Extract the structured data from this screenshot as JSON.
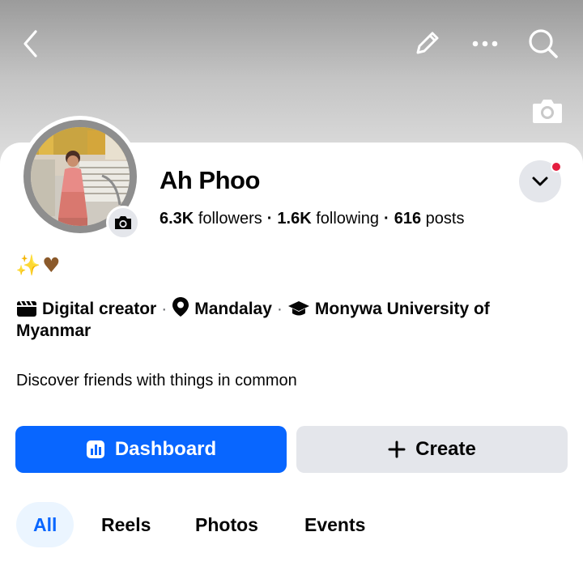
{
  "header": {
    "back_icon": "chevron-left-icon",
    "edit_icon": "pencil-icon",
    "more_icon": "more-horizontal-icon",
    "search_icon": "search-icon",
    "cover_camera_icon": "camera-icon"
  },
  "profile": {
    "name": "Ah Phoo",
    "followers_count": "6.3K",
    "followers_label": "followers",
    "following_count": "1.6K",
    "following_label": "following",
    "posts_count": "616",
    "posts_label": "posts",
    "separator": "·",
    "has_notification": true,
    "notification_color": "#e41e3f"
  },
  "bio": {
    "emoji_sparkle": "✨",
    "emoji_heart": "♥"
  },
  "intro": {
    "category": "Digital creator",
    "location": "Mandalay",
    "education": "Monywa University of Myanmar",
    "separator": "·"
  },
  "discover_text": "Discover friends with things in common",
  "actions": {
    "dashboard_label": "Dashboard",
    "create_label": "Create",
    "primary_color": "#0866ff"
  },
  "tabs": [
    {
      "label": "All",
      "active": true
    },
    {
      "label": "Reels",
      "active": false
    },
    {
      "label": "Photos",
      "active": false
    },
    {
      "label": "Events",
      "active": false
    }
  ]
}
